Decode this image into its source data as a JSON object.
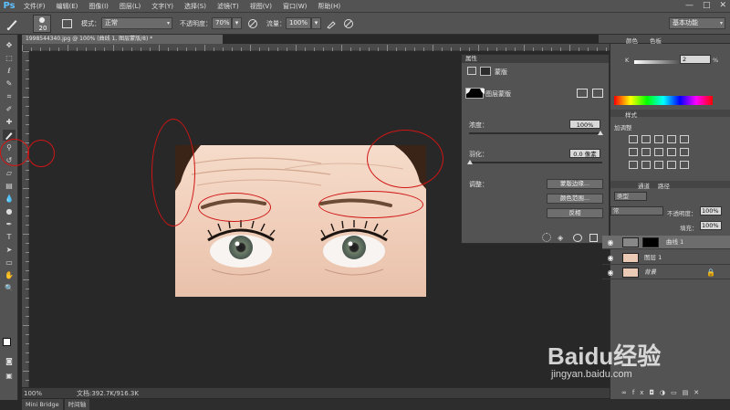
{
  "app": {
    "logo": "Ps",
    "menu": [
      "文件(F)",
      "编辑(E)",
      "图像(I)",
      "图层(L)",
      "文字(Y)",
      "选择(S)",
      "滤镜(T)",
      "视图(V)",
      "窗口(W)",
      "帮助(H)"
    ],
    "window_controls": [
      "—",
      "□",
      "✕"
    ]
  },
  "options": {
    "brush_size": "20",
    "mode_label": "模式：",
    "mode_value": "正常",
    "opacity_label": "不透明度：",
    "opacity_value": "70%",
    "flow_label": "流量：",
    "flow_value": "100%",
    "workspace": "基本功能"
  },
  "document": {
    "tab_title": "1998544340.jpg @ 100% (曲线 1, 图层蒙版/8) *",
    "zoom": "100%",
    "doc_info": "文档:392.7K/916.3K"
  },
  "bottom_tabs": [
    "Mini Bridge",
    "时间轴"
  ],
  "properties": {
    "title": "属性",
    "mask_tab": "蒙版",
    "mask_type": "图层蒙版",
    "density_label": "浓度：",
    "density_value": "100%",
    "feather_label": "羽化：",
    "feather_value": "0.0 像素",
    "adjust_label": "调整：",
    "btn_mask_edge": "蒙版边缘...",
    "btn_color_range": "颜色范围...",
    "btn_invert": "反相"
  },
  "right_dock": {
    "tabs": [
      "颜色",
      "色板"
    ],
    "k_label": "K",
    "k_value": "2",
    "k_unit": "%",
    "style_tab": "样式",
    "adjust_title": "加调整",
    "layer_tabs": [
      "通道",
      "路径"
    ],
    "kind_label": "类型",
    "blend_mode": "常",
    "opacity_label": "不透明度：",
    "opacity_value": "100%",
    "fill_label": "填充：",
    "fill_value": "100%",
    "layers": [
      {
        "name": "曲线 1"
      },
      {
        "name": "图层 1"
      },
      {
        "name": "背景"
      }
    ]
  },
  "watermark": {
    "brand": "Baidu经验",
    "url": "jingyan.baidu.com"
  },
  "colors": {
    "ui_bg": "#535353",
    "canvas_bg": "#282828",
    "annotation_red": "#d01515",
    "ps_blue": "#5ec1ff"
  },
  "icons": {
    "brush": "brush-icon",
    "eye": "eye-icon",
    "lock": "lock-icon"
  }
}
